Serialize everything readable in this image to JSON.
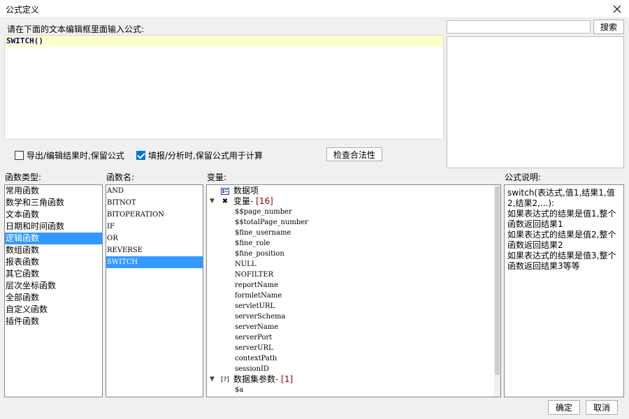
{
  "window": {
    "title": "公式定义"
  },
  "editor": {
    "prompt": "请在下面的文本编辑框里面输入公式:",
    "content": "SWITCH()"
  },
  "search": {
    "placeholder": "",
    "button_label": "搜索"
  },
  "options": {
    "export_label": "导出/编辑结果时,保留公式",
    "export_checked": false,
    "fill_label": "填报/分析时,保留公式用于计算",
    "fill_checked": true,
    "check_button_label": "检查合法性"
  },
  "labels": {
    "func_type": "函数类型:",
    "func_name": "函数名:",
    "variables": "变量:",
    "description": "公式说明:"
  },
  "func_types": [
    "常用函数",
    "数学和三角函数",
    "文本函数",
    "日期和时间函数",
    "逻辑函数",
    "数组函数",
    "报表函数",
    "其它函数",
    "层次坐标函数",
    "全部函数",
    "自定义函数",
    "插件函数"
  ],
  "func_types_selected": "逻辑函数",
  "func_names": [
    "AND",
    "BITNOT",
    "BITOPERATION",
    "IF",
    "OR",
    "REVERSE",
    "SWITCH"
  ],
  "func_names_selected": "SWITCH",
  "variables": {
    "data_item": "数据项",
    "var_group_label": "变量",
    "var_group_count": " - [16]",
    "var_items": [
      "$$page_number",
      "$$totalPage_number",
      "$fine_username",
      "$fine_role",
      "$fine_position",
      "NULL",
      "NOFILTER",
      "reportName",
      "formletName",
      "servletURL",
      "serverSchema",
      "serverName",
      "serverPort",
      "serverURL",
      "contextPath",
      "sessionID"
    ],
    "dataset_label": "数据集参数",
    "dataset_count": " - [1]",
    "dataset_items": [
      "$a"
    ]
  },
  "description": {
    "lines": [
      "switch(表达式,值1,结果1,值2,结果2,...):",
      "如果表达式的结果是值1,整个函数返回结果1",
      "如果表达式的结果是值2,整个函数返回结果2",
      "如果表达式的结果是值3,整个函数返回结果3等等"
    ]
  },
  "buttons": {
    "ok": "确定",
    "cancel": "取消"
  },
  "colors": {
    "selection": "#3399ff",
    "editor_line": "#ffffcc",
    "checkbox_on": "#0078d7"
  }
}
